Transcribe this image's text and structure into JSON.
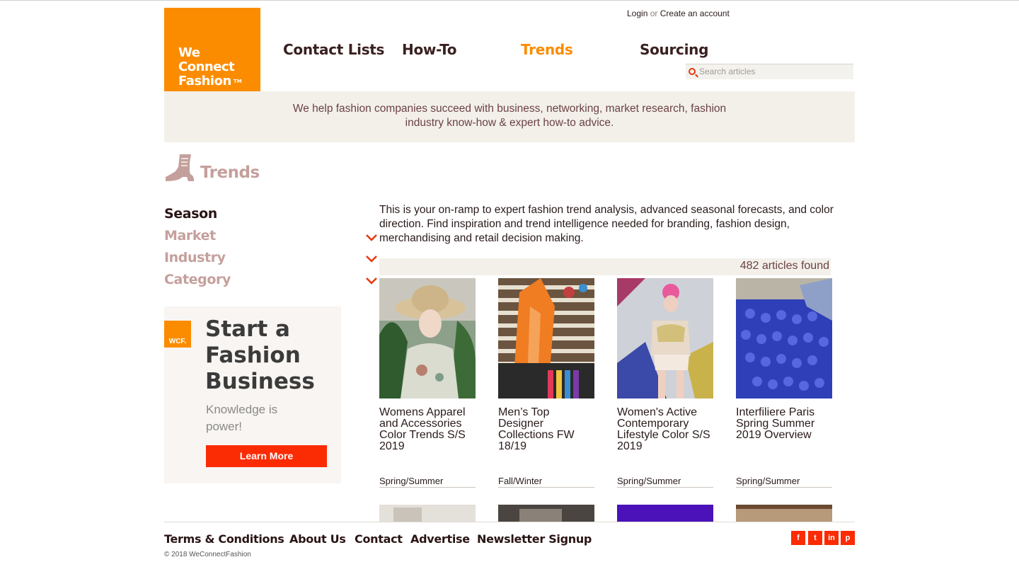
{
  "header": {
    "logo_lines": [
      "We",
      "Connect",
      "Fashion"
    ],
    "logo_mark": "TM",
    "login": "Login",
    "or": "or",
    "create_account": "Create an account",
    "nav": [
      "Contact Lists",
      "How-To",
      "Trends",
      "Sourcing"
    ],
    "search_placeholder": "Search articles",
    "tagline": "We help fashion companies succeed with business, networking, market research, fashion industry know-how & expert how-to advice."
  },
  "section": {
    "title": "Trends",
    "icon": "boot-icon"
  },
  "filters": [
    "Season",
    "Market",
    "Industry",
    "Category"
  ],
  "promo": {
    "badge": "WCF.",
    "title": "Start a Fashion Business",
    "subtitle": "Knowledge is power!",
    "button": "Learn More"
  },
  "main": {
    "intro": "This is your on-ramp to expert fashion trend analysis, advanced seasonal forecasts, and color direction. Find inspiration and trend intelligence needed for branding, fashion design, merchandising and retail decision making.",
    "count": "482 articles found",
    "articles": [
      {
        "title": "Womens Apparel and Accessories Color Trends S/S 2019",
        "season": "Spring/Summer"
      },
      {
        "title": "Men’s Top Designer Collections FW 18/19",
        "season": "Fall/Winter"
      },
      {
        "title": "Women's Active Contemporary Lifestyle Color S/S 2019",
        "season": "Spring/Summer"
      },
      {
        "title": "Interfiliere Paris Spring Summer 2019 Overview",
        "season": "Spring/Summer"
      }
    ]
  },
  "footer": {
    "links": [
      "Terms & Conditions",
      "About Us",
      "Contact",
      "Advertise",
      "Newsletter Signup"
    ],
    "copyright": "© 2018 WeConnectFashion",
    "social": [
      "f",
      "t",
      "in",
      "p"
    ]
  },
  "colors": {
    "brand_orange": "#fb8c00",
    "accent_red": "#fb2b04",
    "muted_pink": "#c4a09c",
    "band": "#f3f0ea"
  }
}
